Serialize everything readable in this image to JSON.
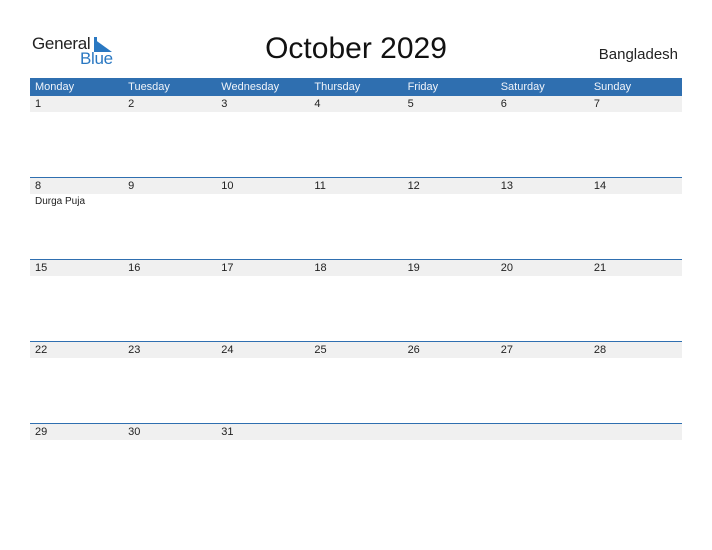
{
  "brand": {
    "word1": "General",
    "word2": "Blue",
    "accent": "#2a78c2"
  },
  "title": "October 2029",
  "country": "Bangladesh",
  "colors": {
    "header_bg": "#2f6fb0",
    "date_strip_bg": "#f0f0f0"
  },
  "weekdays": [
    "Monday",
    "Tuesday",
    "Wednesday",
    "Thursday",
    "Friday",
    "Saturday",
    "Sunday"
  ],
  "weeks": [
    {
      "days": [
        "1",
        "2",
        "3",
        "4",
        "5",
        "6",
        "7"
      ],
      "events": [
        "",
        "",
        "",
        "",
        "",
        "",
        ""
      ]
    },
    {
      "days": [
        "8",
        "9",
        "10",
        "11",
        "12",
        "13",
        "14"
      ],
      "events": [
        "Durga Puja",
        "",
        "",
        "",
        "",
        "",
        ""
      ]
    },
    {
      "days": [
        "15",
        "16",
        "17",
        "18",
        "19",
        "20",
        "21"
      ],
      "events": [
        "",
        "",
        "",
        "",
        "",
        "",
        ""
      ]
    },
    {
      "days": [
        "22",
        "23",
        "24",
        "25",
        "26",
        "27",
        "28"
      ],
      "events": [
        "",
        "",
        "",
        "",
        "",
        "",
        ""
      ]
    },
    {
      "days": [
        "29",
        "30",
        "31",
        "",
        "",
        "",
        ""
      ],
      "events": [
        "",
        "",
        "",
        "",
        "",
        "",
        ""
      ]
    }
  ]
}
